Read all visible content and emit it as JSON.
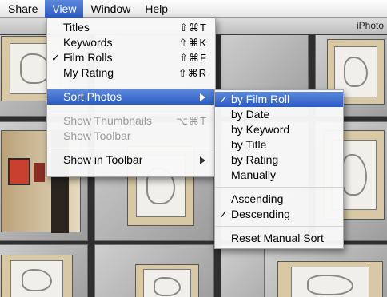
{
  "menubar": {
    "items": [
      {
        "label": "Share"
      },
      {
        "label": "View"
      },
      {
        "label": "Window"
      },
      {
        "label": "Help"
      }
    ]
  },
  "window": {
    "title": "iPhoto"
  },
  "view_menu": {
    "items": [
      {
        "label": "Titles",
        "shortcut": "⇧⌘T",
        "checked": false
      },
      {
        "label": "Keywords",
        "shortcut": "⇧⌘K",
        "checked": false
      },
      {
        "label": "Film Rolls",
        "shortcut": "⇧⌘F",
        "checked": true,
        "checkmark": "✓"
      },
      {
        "label": "My Rating",
        "shortcut": "⇧⌘R",
        "checked": false
      },
      {
        "label": "Sort Photos"
      },
      {
        "label": "Show Thumbnails",
        "shortcut": "⌥⌘T",
        "disabled": true
      },
      {
        "label": "Show Toolbar",
        "disabled": true
      },
      {
        "label": "Show in Toolbar"
      }
    ]
  },
  "sort_menu": {
    "items": [
      {
        "label": "by Film Roll",
        "checked": true,
        "checkmark": "✓"
      },
      {
        "label": "by Date"
      },
      {
        "label": "by Keyword"
      },
      {
        "label": "by Title"
      },
      {
        "label": "by Rating"
      },
      {
        "label": "Manually"
      },
      {
        "label": "Ascending"
      },
      {
        "label": "Descending",
        "checked": true,
        "checkmark": "✓"
      },
      {
        "label": "Reset Manual Sort"
      }
    ]
  },
  "colors": {
    "highlight": "#2a5bc5",
    "disabled_text": "#9a9a9a"
  }
}
